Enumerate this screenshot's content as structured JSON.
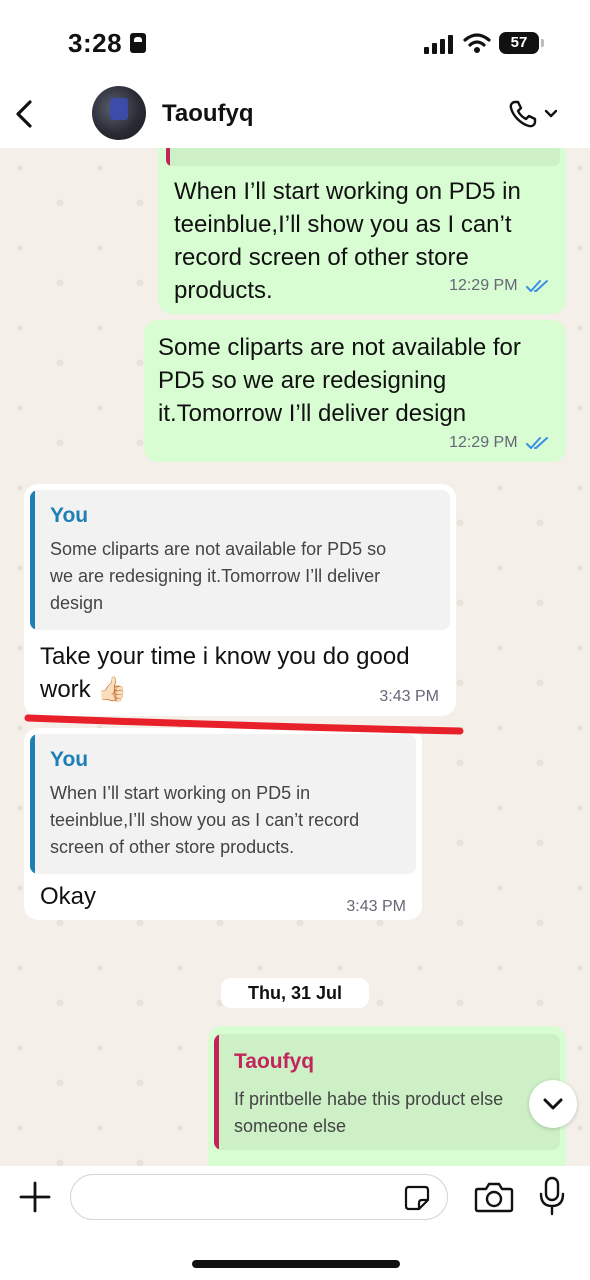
{
  "status_bar": {
    "time": "3:28",
    "battery": "57"
  },
  "header": {
    "contact_name": "Taoufyq"
  },
  "messages": [
    {
      "direction": "outgoing",
      "text": "When I’ll start working on PD5 in teeinblue,I’ll show you as I can’t record screen of other store products.",
      "lines": [
        "When I’ll start working on PD5 in",
        "teeinblue,I’ll show you as I can’t",
        "record screen of other store",
        "products."
      ],
      "time": "12:29 PM",
      "read": true
    },
    {
      "direction": "outgoing",
      "text": "Some cliparts are not available for PD5 so we are redesigning it.Tomorrow I’ll deliver design",
      "lines": [
        "Some cliparts are not available for",
        "PD5 so we are redesigning",
        "it.Tomorrow I’ll deliver design"
      ],
      "time": "12:29 PM",
      "read": true
    },
    {
      "direction": "incoming",
      "quote_author": "You",
      "quote_lines": [
        "Some cliparts are not available for PD5 so",
        "we are redesigning it.Tomorrow I’ll deliver",
        "design"
      ],
      "lines": [
        "Take your time i know you do good",
        "work 👍🏻"
      ],
      "time": "3:43 PM"
    },
    {
      "direction": "incoming",
      "quote_author": "You",
      "quote_lines": [
        "When I’ll start working on PD5 in",
        "teeinblue,I’ll show you as I can’t record",
        "screen of other store products."
      ],
      "lines": [
        "Okay"
      ],
      "time": "3:43 PM"
    },
    {
      "direction": "outgoing",
      "quote_author": "Taoufyq",
      "quote_lines": [
        "If printbelle habe this product else",
        "someone else"
      ]
    }
  ],
  "date_separator": "Thu, 31 Jul",
  "input": {
    "placeholder": "",
    "value": ""
  },
  "colors": {
    "outgoing_bubble": "#d8fdd2",
    "incoming_bubble": "#ffffff",
    "quote_you": "#1f7fb5",
    "quote_contact": "#c2255c",
    "read_ticks": "#3a8ee6",
    "annotation_line": "#e8202a"
  },
  "icons": [
    "back-icon",
    "phone-icon",
    "chevron-down-icon",
    "plus-icon",
    "sticker-icon",
    "camera-icon",
    "mic-icon",
    "double-check-icon",
    "signal-icon",
    "wifi-icon",
    "id-card-icon"
  ]
}
